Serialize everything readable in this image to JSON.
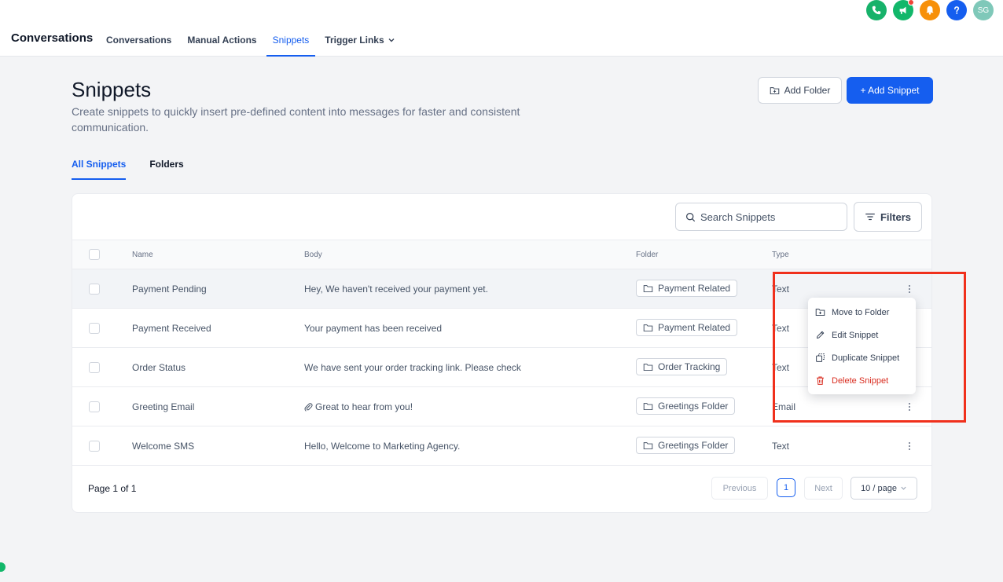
{
  "app": {
    "brand": "Conversations",
    "nav": [
      {
        "label": "Conversations",
        "active": false
      },
      {
        "label": "Manual Actions",
        "active": false
      },
      {
        "label": "Snippets",
        "active": true
      },
      {
        "label": "Trigger Links",
        "active": false
      }
    ],
    "header_icons": [
      {
        "icon": "phone-icon",
        "color": "#17b26a"
      },
      {
        "icon": "megaphone-icon",
        "color": "#12b76a"
      },
      {
        "icon": "bell-icon",
        "color": "#f79009"
      },
      {
        "icon": "help-icon",
        "color": "#155eef"
      },
      {
        "icon": "avatar",
        "color": "#7fc8b9",
        "initials": "SG"
      }
    ]
  },
  "page": {
    "title": "Snippets",
    "description": "Create snippets to quickly insert pre-defined content into messages for faster and consistent communication.",
    "add_folder": "Add Folder",
    "add_snippet": "+ Add Snippet",
    "tabs": [
      {
        "label": "All Snippets",
        "active": true
      },
      {
        "label": "Folders",
        "active": false
      }
    ]
  },
  "table": {
    "search_placeholder": "Search Snippets",
    "filters_label": "Filters",
    "columns": [
      "Name",
      "Body",
      "Folder",
      "Type"
    ],
    "rows": [
      {
        "name": "Payment Pending",
        "body": "Hey, We haven't received your payment yet.",
        "folder": "Payment Related",
        "type": "Text",
        "attachment": false
      },
      {
        "name": "Payment Received",
        "body": "Your payment has been received",
        "folder": "Payment Related",
        "type": "Text",
        "attachment": false
      },
      {
        "name": "Order Status",
        "body": "We have sent your order tracking link. Please check",
        "folder": "Order Tracking",
        "type": "Text",
        "attachment": false
      },
      {
        "name": "Greeting Email",
        "body": "Great to hear from you!",
        "folder": "Greetings Folder",
        "type": "Email",
        "attachment": true
      },
      {
        "name": "Welcome SMS",
        "body": "Hello, Welcome to Marketing Agency.",
        "folder": "Greetings Folder",
        "type": "Text",
        "attachment": false
      }
    ],
    "pagination": {
      "page_text": "Page 1 of 1",
      "previous": "Previous",
      "current": "1",
      "next": "Next",
      "page_size": "10 / page"
    }
  },
  "context_menu": {
    "items": [
      {
        "label": "Move to Folder",
        "icon": "move-folder-icon"
      },
      {
        "label": "Edit Snippet",
        "icon": "pencil-icon"
      },
      {
        "label": "Duplicate Snippet",
        "icon": "duplicate-icon"
      },
      {
        "label": "Delete Snippet",
        "icon": "trash-icon"
      }
    ]
  },
  "colors": {
    "accent": "#155eef",
    "danger": "#d92d20",
    "highlight": "#f0301c"
  }
}
